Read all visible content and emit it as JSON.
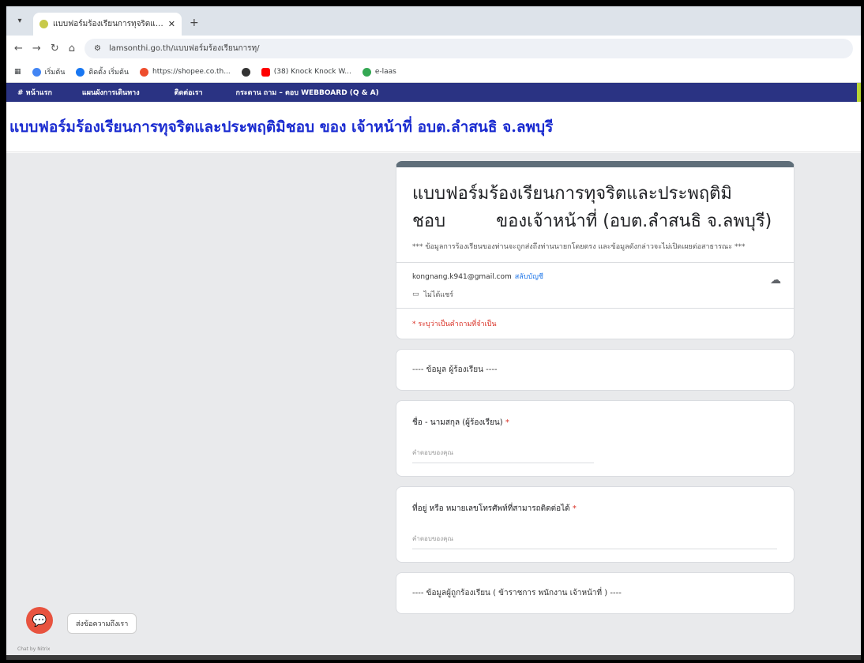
{
  "browser": {
    "tab_title": "แบบฟอร์มร้องเรียนการทุจริตและประพฤติมิชอบ",
    "url": "lamsonthi.go.th/แบบฟอร์มร้องเรียนการทุ/",
    "bookmarks": [
      {
        "label": "เริ่มต้น",
        "color": "#4285f4"
      },
      {
        "label": "ติดตั้ง เริ่มต้น",
        "color": "#1877f2"
      },
      {
        "label": "https://shopee.co.th...",
        "color": "#ee4d2d"
      },
      {
        "label": "",
        "color": "#333333"
      },
      {
        "label": "(38) Knock Knock W...",
        "color": "#ff0000"
      },
      {
        "label": "e-laas",
        "color": "#34a853"
      }
    ]
  },
  "site": {
    "nav": [
      "# หน้าแรก",
      "แผนผังการเดินทาง",
      "ติดต่อเรา",
      "กระดาน ถาม – ตอบ WEBBOARD (Q & A)"
    ],
    "page_title": "แบบฟอร์มร้องเรียนการทุจริตและประพฤติมิชอบ ของ เจ้าหน้าที่ อบต.ลำสนธิ จ.ลพบุรี"
  },
  "form": {
    "title_line1": "แบบฟอร์มร้องเรียนการทุจริตและประพฤติมิ",
    "title_line2a": "ชอบ",
    "title_line2b": "ของเจ้าหน้าที่ (อบต.ลำสนธิ จ.ลพบุรี)",
    "description": "*** ข้อมูลการร้องเรียนของท่านจะถูกส่งถึงท่านนายกโดยตรง และข้อมูลดังกล่าวจะไม่เปิดเผยต่อสาธารณะ ***",
    "account_email": "kongnang.k941@gmail.com",
    "switch_account": "สลับบัญชี",
    "not_saved": "ไม่ได้แชร์",
    "required_note": "* ระบุว่าเป็นคำถามที่จำเป็น",
    "section1": "---- ข้อมูล ผู้ร้องเรียน ----",
    "q1_label": "ชื่อ - นามสกุล (ผู้ร้องเรียน)",
    "q1_placeholder": "คำตอบของคุณ",
    "q2_label": "ที่อยู่ หรือ หมายเลขโทรศัพท์ที่สามารถติดต่อได้",
    "q2_placeholder": "คำตอบของคุณ",
    "section2": "---- ข้อมูลผู้ถูกร้องเรียน ( ข้าราชการ พนักงาน เจ้าหน้าที่ ) ----"
  },
  "chat": {
    "tooltip": "ส่งข้อความถึงเรา",
    "powered": "Chat by Nitrix"
  },
  "colors": {
    "nav_bg": "#2a3383",
    "title_blue": "#1a2bd0",
    "form_accent": "#5f6e79",
    "chat_button": "#e8533f"
  }
}
